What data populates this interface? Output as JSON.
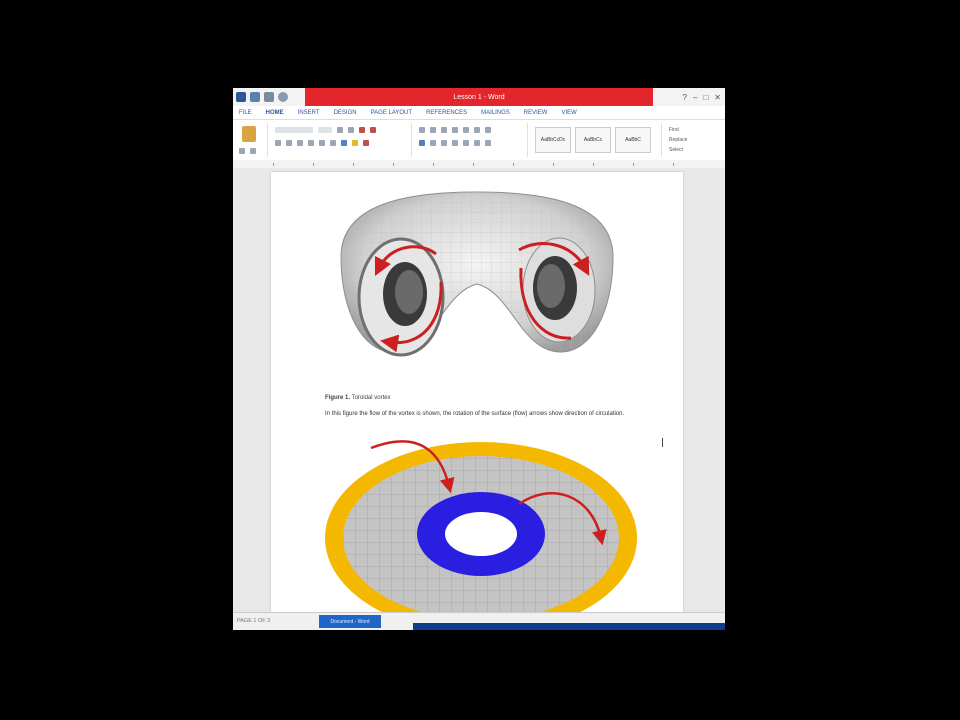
{
  "window": {
    "title": "Lesson 1 - Word",
    "colors": {
      "title_bar": "#e2262b",
      "page": "#ffffff",
      "taskbar": "#1f66c9"
    }
  },
  "ribbon_tabs": [
    "FILE",
    "HOME",
    "INSERT",
    "DESIGN",
    "PAGE LAYOUT",
    "REFERENCES",
    "MAILINGS",
    "REVIEW",
    "VIEW"
  ],
  "ribbon": {
    "style_gallery": [
      "AaBbCcDc",
      "AaBbCc",
      "AaBbC"
    ],
    "editing": [
      "Find",
      "Replace",
      "Select"
    ]
  },
  "document": {
    "figure1": {
      "caption_label": "Figure 1.",
      "caption_text": "Toroidal vortex"
    },
    "paragraph": "In this figure the flow of the vortex is shown, the rotation of the surface (flow)\narrows show direction of circulation.",
    "figure2": {
      "ring_colors": {
        "outer": "#f5b800",
        "inner": "#2a1fe0",
        "surface": "#b9b9b9"
      }
    }
  },
  "status_bar": {
    "text": "PAGE 1 OF 3",
    "taskbar_item": "Document - Word"
  }
}
